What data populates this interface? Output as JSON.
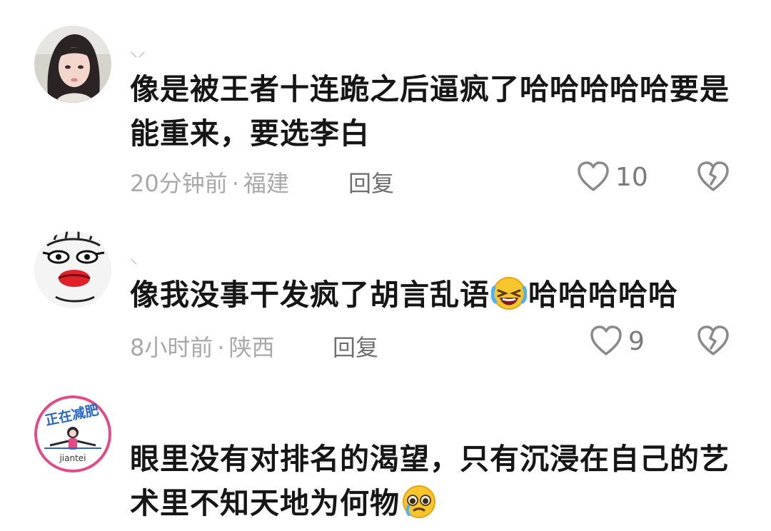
{
  "comments": [
    {
      "username": "⸜⸝",
      "text": "像是被王者十连跪之后逼疯了哈哈哈哈哈要是能重来，要选李白",
      "time": "20分钟前",
      "location": "福建",
      "reply_label": "回复",
      "like_count": "10",
      "avatar_icon": "girl-photo-avatar"
    },
    {
      "username": "⸜",
      "text_before_emoji": "像我没事干发疯了胡言乱语",
      "emoji": "laughing-crying-emoji",
      "text_after_emoji": "哈哈哈哈哈",
      "time": "8小时前",
      "location": "陕西",
      "reply_label": "回复",
      "like_count": "9",
      "avatar_icon": "cartoon-face-avatar"
    },
    {
      "avatar_top_text": "正在减肥",
      "avatar_bottom_text": "jiantei",
      "text_before_emoji": "眼里没有对排名的渴望，只有沉浸在自己的艺术里不知天地为何物",
      "emoji": "teary-eyed-emoji",
      "avatar_icon": "diet-badge-avatar"
    }
  ],
  "separator": "·",
  "colors": {
    "text": "#161616",
    "meta": "#a9a9a9",
    "icon": "#8a8a8a"
  }
}
